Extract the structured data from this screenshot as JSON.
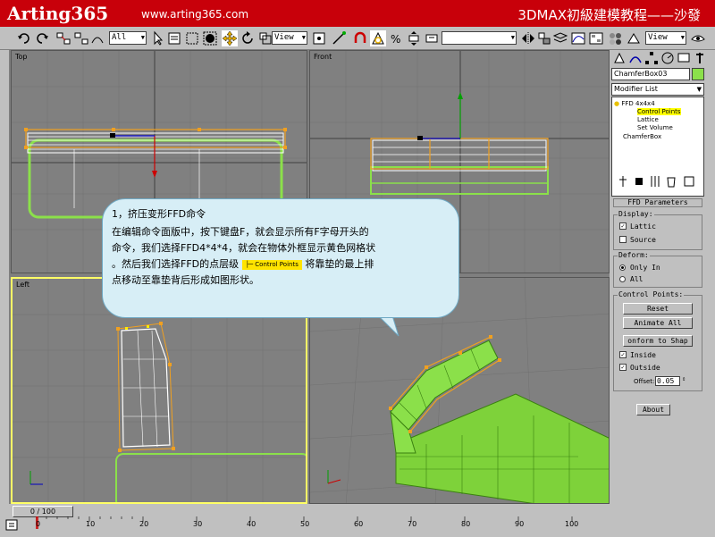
{
  "banner": {
    "brand": "Arting365",
    "url": "www.arting365.com",
    "title": "3DMAX初級建模教程——沙發"
  },
  "toolbar": {
    "selection_filter": "All",
    "coord_system_left": "View",
    "coord_system_right": "View"
  },
  "viewports": {
    "top": "Top",
    "front": "Front",
    "left": "Left"
  },
  "command_panel": {
    "object_name": "ChamferBox03",
    "modifier_list": "Modifier List",
    "stack": {
      "ffd": "FFD 4x4x4",
      "control_points": "Control Points",
      "lattice": "Lattice",
      "set_volume": "Set Volume",
      "base": "ChamferBox"
    },
    "rollout_title": "FFD Parameters",
    "display": {
      "label": "Display:",
      "lattice": "Lattic",
      "source": "Source"
    },
    "deform": {
      "label": "Deform:",
      "only_in": "Only In",
      "all": "All"
    },
    "control_points": {
      "label": "Control Points:",
      "reset": "Reset",
      "animate_all": "Animate All",
      "conform": "onform to Shap",
      "inside": "Inside",
      "outside": "Outside",
      "offset_label": "Offset:",
      "offset_value": "0.05"
    },
    "about": "About"
  },
  "timeline": {
    "frame": "0 / 100",
    "ticks": [
      "0",
      "10",
      "20",
      "30",
      "40",
      "50",
      "60",
      "70",
      "80",
      "90",
      "100"
    ]
  },
  "callout": {
    "title": "1，挤压变形FFD命令",
    "line1": "在编辑命令面版中，按下键盘F，就会显示所有F字母开头的",
    "line2": "命令，我们选择FFD4*4*4，就会在物体外框显示黄色网格状",
    "line3a": "。然后我们选择FFD的点层级",
    "tag": "Control Points",
    "line3b": "将靠垫的最上排",
    "line4": "点移动至靠垫背后形成如图形状。"
  }
}
